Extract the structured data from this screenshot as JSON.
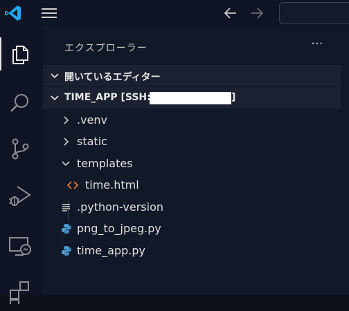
{
  "titlebar": {
    "colors": {
      "logo": "#23a5f0",
      "icon": "#cfcfcf",
      "icon_disabled": "#6b6f78"
    }
  },
  "activity_bar": {
    "items": [
      {
        "icon": "files-icon",
        "active": true
      },
      {
        "icon": "search-icon",
        "active": false
      },
      {
        "icon": "source-control-icon",
        "active": false
      },
      {
        "icon": "run-debug-icon",
        "active": false
      },
      {
        "icon": "remote-explorer-icon",
        "active": false
      },
      {
        "icon": "extensions-icon",
        "active": false
      }
    ]
  },
  "explorer": {
    "title": "エクスプローラー",
    "more": "···",
    "open_editors_label": "開いているエディター",
    "workspace_label": "TIME_APP [SSH: ",
    "workspace_label_end": "]",
    "tree": {
      "venv": ".venv",
      "static": "static",
      "templates": "templates",
      "time_html": "time.html",
      "python_version": ".python-version",
      "png_to_jpeg": "png_to_jpeg.py",
      "time_app": "time_app.py"
    },
    "colors": {
      "html_icon": "#e37933",
      "python_icon": "#4e9ed4",
      "text_icon": "#cfcfcf"
    }
  }
}
